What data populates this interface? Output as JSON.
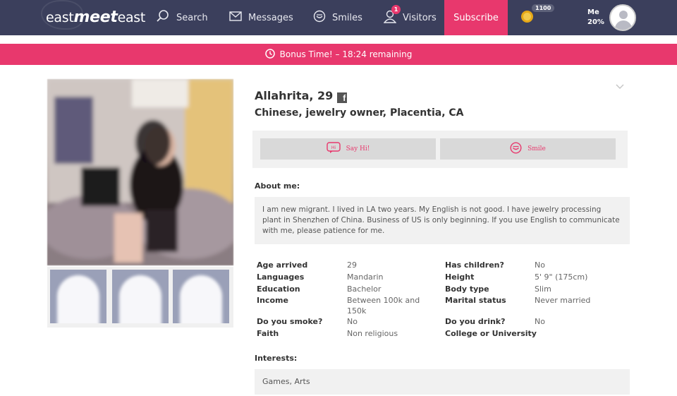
{
  "header": {
    "logo": {
      "left": "east",
      "mid": "meet",
      "right": "east"
    },
    "nav": [
      {
        "id": "search",
        "label": "Search",
        "icon": "search-icon"
      },
      {
        "id": "messages",
        "label": "Messages",
        "icon": "envelope-icon"
      },
      {
        "id": "smiles",
        "label": "Smiles",
        "icon": "smile-icon"
      },
      {
        "id": "visitors",
        "label": "Visitors",
        "icon": "user-icon",
        "badge": "1"
      }
    ],
    "subscribe_label": "Subscribe",
    "coins": "1100",
    "me_label": "Me",
    "me_percent": "20%"
  },
  "bonus": {
    "text": "Bonus Time! – 18:24 remaining",
    "icon": "clock-icon"
  },
  "profile": {
    "name": "Allahrita, 29",
    "subtitle": "Chinese, jewelry owner, Placentia, CA",
    "say_hi_label": "Say Hi!",
    "smile_label": "Smile",
    "about_title": "About me:",
    "about_text": "I am new migrant. I lived in LA two years. My English is not good. I have jewelry processing plant in Shenzhen of China. Business of US is only beginning. If you use English to communicate with me, please patience for me.",
    "details": [
      {
        "label": "Age arrived",
        "value": "29"
      },
      {
        "label": "Has children?",
        "value": "No"
      },
      {
        "label": "Languages",
        "value": "Mandarin"
      },
      {
        "label": "Height",
        "value": "5' 9\" (175cm)"
      },
      {
        "label": "Education",
        "value": "Bachelor"
      },
      {
        "label": "Body type",
        "value": "Slim"
      },
      {
        "label": "Income",
        "value": "Between 100k and 150k"
      },
      {
        "label": "Marital status",
        "value": "Never married"
      },
      {
        "label": "Do you smoke?",
        "value": "No"
      },
      {
        "label": "Do you drink?",
        "value": "No"
      },
      {
        "label": "Faith",
        "value": "Non religious"
      },
      {
        "label": "College or University",
        "value": ""
      }
    ],
    "interests_title": "Interests:",
    "interests": "Games, Arts"
  },
  "colors": {
    "nav_bg": "#3b3f5c",
    "accent": "#e8386d"
  }
}
